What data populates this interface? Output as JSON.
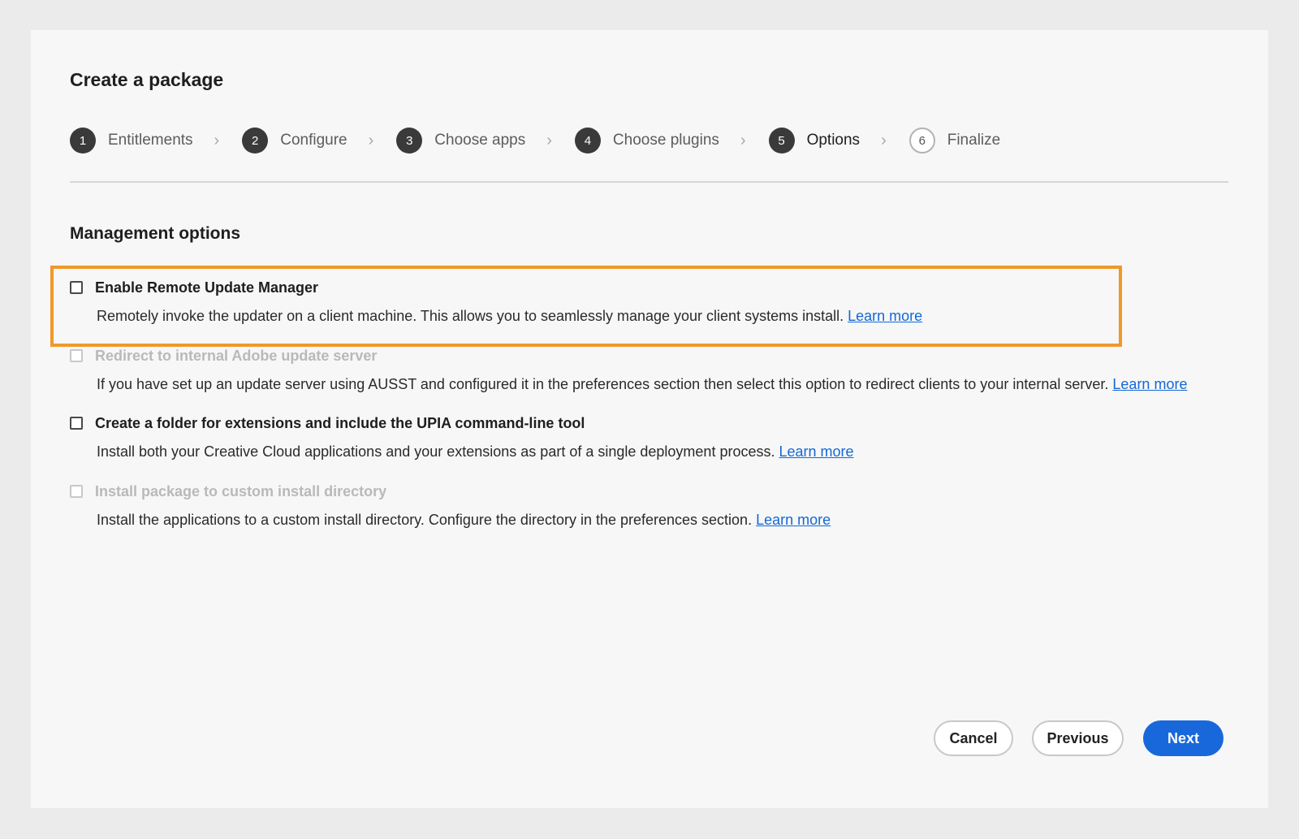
{
  "dialog": {
    "title": "Create a package"
  },
  "stepper": {
    "steps": [
      {
        "number": "1",
        "label": "Entitlements"
      },
      {
        "number": "2",
        "label": "Configure"
      },
      {
        "number": "3",
        "label": "Choose apps"
      },
      {
        "number": "4",
        "label": "Choose plugins"
      },
      {
        "number": "5",
        "label": "Options"
      },
      {
        "number": "6",
        "label": "Finalize"
      }
    ],
    "active_step": "5",
    "separator_icon": "chevron-right-icon"
  },
  "management": {
    "title": "Management options",
    "options": [
      {
        "label": "Enable Remote Update Manager",
        "description": "Remotely invoke the updater on a client machine. This allows you to seamlessly manage your client systems install.",
        "link": "Learn more",
        "checked": false,
        "disabled": false,
        "highlighted": true
      },
      {
        "label": "Redirect to internal Adobe update server",
        "description": "If you have set up an update server using AUSST and configured it in the preferences section then select this option to redirect clients to your internal server.",
        "link": "Learn more",
        "checked": false,
        "disabled": true,
        "highlighted": false
      },
      {
        "label": "Create a folder for extensions and include the UPIA command-line tool",
        "description": "Install both your Creative Cloud applications and your extensions as part of a single deployment process.",
        "link": "Learn more",
        "checked": false,
        "disabled": false,
        "highlighted": false
      },
      {
        "label": "Install package to custom install directory",
        "description": "Install the applications to a custom install directory. Configure the directory in the preferences section.",
        "link": "Learn more",
        "checked": false,
        "disabled": true,
        "highlighted": false
      }
    ]
  },
  "footer": {
    "cancel_label": "Cancel",
    "previous_label": "Previous",
    "next_label": "Next"
  },
  "colors": {
    "highlight": "#f0982a",
    "primary": "#1868db",
    "link": "#1468d6"
  }
}
